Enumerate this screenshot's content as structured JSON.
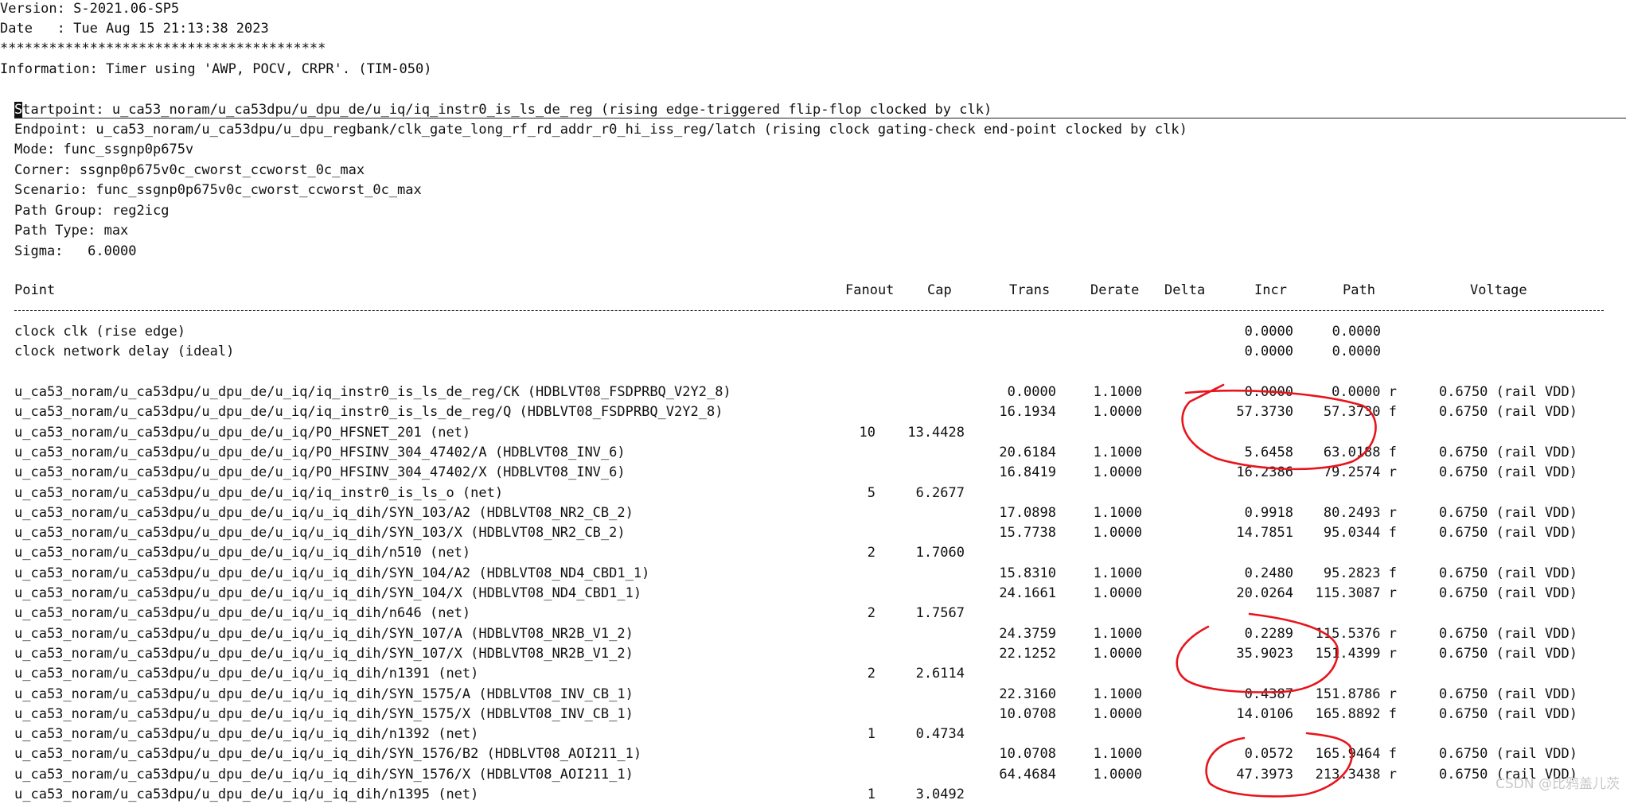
{
  "header": {
    "version": "Version: S-2021.06-SP5",
    "date": "Date   : Tue Aug 15 21:13:38 2023",
    "stars": "****************************************",
    "information": "Information: Timer using 'AWP, POCV, CRPR'. (TIM-050)"
  },
  "path_info": {
    "startpoint_first_char": "S",
    "startpoint_rest": "tartpoint: u_ca53_noram/u_ca53dpu/u_dpu_de/u_iq/iq_instr0_is_ls_de_reg (rising edge-triggered flip-flop clocked by clk)",
    "endpoint": "Endpoint: u_ca53_noram/u_ca53dpu/u_dpu_regbank/clk_gate_long_rf_rd_addr_r0_hi_iss_reg/latch (rising clock gating-check end-point clocked by clk)",
    "mode": "Mode: func_ssgnp0p675v",
    "corner": "Corner: ssgnp0p675v0c_cworst_ccworst_0c_max",
    "scenario": "Scenario: func_ssgnp0p675v0c_cworst_ccworst_0c_max",
    "path_group": "Path Group: reg2icg",
    "path_type": "Path Type: max",
    "sigma": "Sigma:   6.0000"
  },
  "columns": {
    "point": "Point",
    "fanout": "Fanout",
    "cap": "Cap",
    "trans": "Trans",
    "derate": "Derate",
    "delta": "Delta",
    "incr": "Incr",
    "path": "Path",
    "voltage": "Voltage"
  },
  "clock_rows": [
    {
      "point": "clock clk (rise edge)",
      "incr": "0.0000",
      "path": "0.0000"
    },
    {
      "point": "clock network delay (ideal)",
      "incr": "0.0000",
      "path": "0.0000"
    }
  ],
  "rows": [
    {
      "point": "u_ca53_noram/u_ca53dpu/u_dpu_de/u_iq/iq_instr0_is_ls_de_reg/CK (HDBLVT08_FSDPRBQ_V2Y2_8)",
      "fanout": "",
      "cap": "",
      "trans": "0.0000",
      "derate": "1.1000",
      "incr": "0.0000",
      "path": "0.0000 r",
      "voltage": "0.6750 (rail VDD)"
    },
    {
      "point": "u_ca53_noram/u_ca53dpu/u_dpu_de/u_iq/iq_instr0_is_ls_de_reg/Q (HDBLVT08_FSDPRBQ_V2Y2_8)",
      "fanout": "",
      "cap": "",
      "trans": "16.1934",
      "derate": "1.0000",
      "incr": "57.3730",
      "path": "57.3730 f",
      "voltage": "0.6750 (rail VDD)"
    },
    {
      "point": "u_ca53_noram/u_ca53dpu/u_dpu_de/u_iq/PO_HFSNET_201 (net)",
      "fanout": "10",
      "cap": "13.4428",
      "trans": "",
      "derate": "",
      "incr": "",
      "path": "",
      "voltage": ""
    },
    {
      "point": "u_ca53_noram/u_ca53dpu/u_dpu_de/u_iq/PO_HFSINV_304_47402/A (HDBLVT08_INV_6)",
      "fanout": "",
      "cap": "",
      "trans": "20.6184",
      "derate": "1.1000",
      "incr": "5.6458",
      "path": "63.0188 f",
      "voltage": "0.6750 (rail VDD)"
    },
    {
      "point": "u_ca53_noram/u_ca53dpu/u_dpu_de/u_iq/PO_HFSINV_304_47402/X (HDBLVT08_INV_6)",
      "fanout": "",
      "cap": "",
      "trans": "16.8419",
      "derate": "1.0000",
      "incr": "16.2386",
      "path": "79.2574 r",
      "voltage": "0.6750 (rail VDD)"
    },
    {
      "point": "u_ca53_noram/u_ca53dpu/u_dpu_de/u_iq/iq_instr0_is_ls_o (net)",
      "fanout": "5",
      "cap": "6.2677",
      "trans": "",
      "derate": "",
      "incr": "",
      "path": "",
      "voltage": ""
    },
    {
      "point": "u_ca53_noram/u_ca53dpu/u_dpu_de/u_iq/u_iq_dih/SYN_103/A2 (HDBLVT08_NR2_CB_2)",
      "fanout": "",
      "cap": "",
      "trans": "17.0898",
      "derate": "1.1000",
      "incr": "0.9918",
      "path": "80.2493 r",
      "voltage": "0.6750 (rail VDD)"
    },
    {
      "point": "u_ca53_noram/u_ca53dpu/u_dpu_de/u_iq/u_iq_dih/SYN_103/X (HDBLVT08_NR2_CB_2)",
      "fanout": "",
      "cap": "",
      "trans": "15.7738",
      "derate": "1.0000",
      "incr": "14.7851",
      "path": "95.0344 f",
      "voltage": "0.6750 (rail VDD)"
    },
    {
      "point": "u_ca53_noram/u_ca53dpu/u_dpu_de/u_iq/u_iq_dih/n510 (net)",
      "fanout": "2",
      "cap": "1.7060",
      "trans": "",
      "derate": "",
      "incr": "",
      "path": "",
      "voltage": ""
    },
    {
      "point": "u_ca53_noram/u_ca53dpu/u_dpu_de/u_iq/u_iq_dih/SYN_104/A2 (HDBLVT08_ND4_CBD1_1)",
      "fanout": "",
      "cap": "",
      "trans": "15.8310",
      "derate": "1.1000",
      "incr": "0.2480",
      "path": "95.2823 f",
      "voltage": "0.6750 (rail VDD)"
    },
    {
      "point": "u_ca53_noram/u_ca53dpu/u_dpu_de/u_iq/u_iq_dih/SYN_104/X (HDBLVT08_ND4_CBD1_1)",
      "fanout": "",
      "cap": "",
      "trans": "24.1661",
      "derate": "1.0000",
      "incr": "20.0264",
      "path": "115.3087 r",
      "voltage": "0.6750 (rail VDD)"
    },
    {
      "point": "u_ca53_noram/u_ca53dpu/u_dpu_de/u_iq/u_iq_dih/n646 (net)",
      "fanout": "2",
      "cap": "1.7567",
      "trans": "",
      "derate": "",
      "incr": "",
      "path": "",
      "voltage": ""
    },
    {
      "point": "u_ca53_noram/u_ca53dpu/u_dpu_de/u_iq/u_iq_dih/SYN_107/A (HDBLVT08_NR2B_V1_2)",
      "fanout": "",
      "cap": "",
      "trans": "24.3759",
      "derate": "1.1000",
      "incr": "0.2289",
      "path": "115.5376 r",
      "voltage": "0.6750 (rail VDD)"
    },
    {
      "point": "u_ca53_noram/u_ca53dpu/u_dpu_de/u_iq/u_iq_dih/SYN_107/X (HDBLVT08_NR2B_V1_2)",
      "fanout": "",
      "cap": "",
      "trans": "22.1252",
      "derate": "1.0000",
      "incr": "35.9023",
      "path": "151.4399 r",
      "voltage": "0.6750 (rail VDD)"
    },
    {
      "point": "u_ca53_noram/u_ca53dpu/u_dpu_de/u_iq/u_iq_dih/n1391 (net)",
      "fanout": "2",
      "cap": "2.6114",
      "trans": "",
      "derate": "",
      "incr": "",
      "path": "",
      "voltage": ""
    },
    {
      "point": "u_ca53_noram/u_ca53dpu/u_dpu_de/u_iq/u_iq_dih/SYN_1575/A (HDBLVT08_INV_CB_1)",
      "fanout": "",
      "cap": "",
      "trans": "22.3160",
      "derate": "1.1000",
      "incr": "0.4387",
      "path": "151.8786 r",
      "voltage": "0.6750 (rail VDD)"
    },
    {
      "point": "u_ca53_noram/u_ca53dpu/u_dpu_de/u_iq/u_iq_dih/SYN_1575/X (HDBLVT08_INV_CB_1)",
      "fanout": "",
      "cap": "",
      "trans": "10.0708",
      "derate": "1.0000",
      "incr": "14.0106",
      "path": "165.8892 f",
      "voltage": "0.6750 (rail VDD)"
    },
    {
      "point": "u_ca53_noram/u_ca53dpu/u_dpu_de/u_iq/u_iq_dih/n1392 (net)",
      "fanout": "1",
      "cap": "0.4734",
      "trans": "",
      "derate": "",
      "incr": "",
      "path": "",
      "voltage": ""
    },
    {
      "point": "u_ca53_noram/u_ca53dpu/u_dpu_de/u_iq/u_iq_dih/SYN_1576/B2 (HDBLVT08_AOI211_1)",
      "fanout": "",
      "cap": "",
      "trans": "10.0708",
      "derate": "1.1000",
      "incr": "0.0572",
      "path": "165.9464 f",
      "voltage": "0.6750 (rail VDD)"
    },
    {
      "point": "u_ca53_noram/u_ca53dpu/u_dpu_de/u_iq/u_iq_dih/SYN_1576/X (HDBLVT08_AOI211_1)",
      "fanout": "",
      "cap": "",
      "trans": "64.4684",
      "derate": "1.0000",
      "incr": "47.3973",
      "path": "213.3438 r",
      "voltage": "0.6750 (rail VDD)"
    },
    {
      "point": "u_ca53_noram/u_ca53dpu/u_dpu_de/u_iq/u_iq_dih/n1395 (net)",
      "fanout": "1",
      "cap": "3.0492",
      "trans": "",
      "derate": "",
      "incr": "",
      "path": "",
      "voltage": ""
    }
  ],
  "watermark": "CSDN @比鸦盖儿茨",
  "colors": {
    "annotation": "#e8141c",
    "text": "#111111",
    "background": "#ffffff"
  }
}
